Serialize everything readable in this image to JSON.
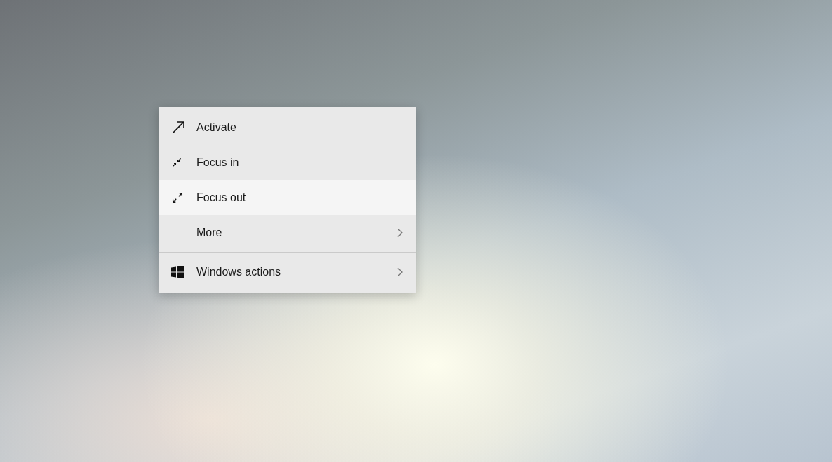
{
  "menu": {
    "sections": [
      {
        "items": [
          {
            "label": "Activate",
            "kind": "arrow",
            "selected": false,
            "submenu": false
          },
          {
            "label": "Focus in",
            "kind": "focus-in",
            "selected": false,
            "submenu": false
          },
          {
            "label": "Focus out",
            "kind": "focus-out",
            "selected": true,
            "submenu": false
          },
          {
            "label": "More",
            "kind": "plain",
            "selected": false,
            "submenu": true
          }
        ]
      },
      {
        "items": [
          {
            "label": "Windows actions",
            "kind": "windows",
            "selected": false,
            "submenu": true
          }
        ]
      }
    ]
  }
}
